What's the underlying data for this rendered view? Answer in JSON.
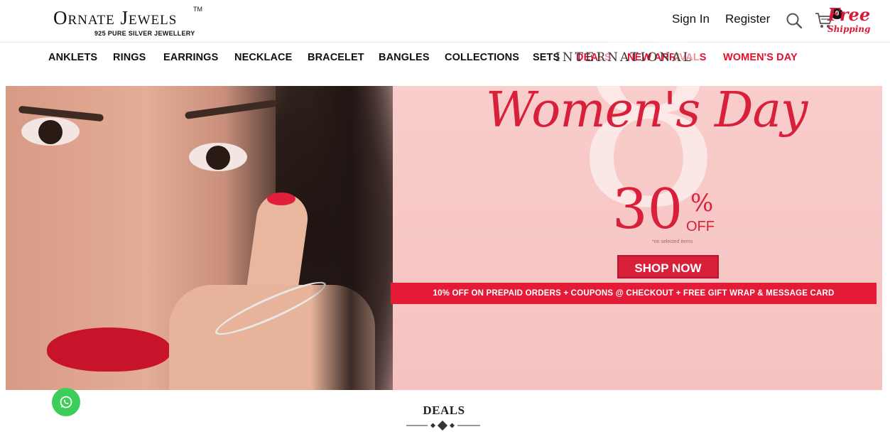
{
  "header": {
    "logo_text": "Ornate Jewels",
    "logo_tm": "TM",
    "logo_tagline": "925 PURE SILVER JEWELLERY",
    "sign_in": "Sign In",
    "register": "Register",
    "search_icon": "search-icon",
    "cart_icon": "cart-icon",
    "cart_count": "0"
  },
  "nav": {
    "items": [
      {
        "label": "ANKLETS"
      },
      {
        "label": "RINGS"
      },
      {
        "label": "EARRINGS"
      },
      {
        "label": "NECKLACE"
      },
      {
        "label": "BRACELET"
      },
      {
        "label": "BANGLES"
      },
      {
        "label": "COLLECTIONS"
      },
      {
        "label": "SETS"
      },
      {
        "label": "DEALS"
      },
      {
        "label": "NEW ARRIVALS"
      },
      {
        "label": "WOMEN'S DAY"
      }
    ],
    "highlight_color": "#e3102e"
  },
  "banner": {
    "big_number": "8",
    "free": "Free",
    "shipping": "Shipping",
    "international": "INTERNATIONAL",
    "headline": "Women's Day",
    "discount": "30",
    "percent_sign": "%",
    "off": "OFF",
    "condition": "*on selected items",
    "cta": "SHOP NOW",
    "strip": "10% OFF ON PREPAID ORDERS + COUPONS @ CHECKOUT + FREE GIFT WRAP & MESSAGE CARD",
    "accent_color": "#d9203a"
  },
  "deals": {
    "title": "DEALS"
  },
  "whatsapp": {
    "icon": "whatsapp-icon"
  }
}
